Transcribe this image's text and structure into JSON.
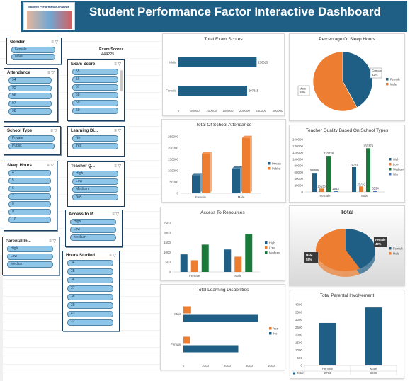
{
  "header": {
    "title": "Student Performance Factor Interactive Dashboard",
    "thumb_title": "Student Performance Analysis"
  },
  "kpi": {
    "label": "Exam Scores",
    "value": "444225"
  },
  "slicers": {
    "gender": {
      "title": "Gender",
      "items": [
        "Female",
        "Male"
      ]
    },
    "attendance": {
      "title": "Attendance",
      "items": [
        "94",
        "95",
        "96",
        "97",
        "98"
      ]
    },
    "exam_score": {
      "title": "Exam Score",
      "items": [
        "55",
        "56",
        "57",
        "58",
        "59",
        "60",
        "61"
      ]
    },
    "school_type": {
      "title": "School Type",
      "items": [
        "Private",
        "Public"
      ]
    },
    "learning_disabilities": {
      "title": "Learning Di...",
      "items": [
        "No",
        "Yes"
      ]
    },
    "sleep_hours": {
      "title": "Sleep Hours",
      "items": [
        "4",
        "5",
        "6",
        "7",
        "8",
        "9",
        "10"
      ]
    },
    "teacher_quality": {
      "title": "Teacher Q...",
      "items": [
        "High",
        "Low",
        "Medium",
        "N/A"
      ]
    },
    "access_to_resources": {
      "title": "Access to R...",
      "items": [
        "High",
        "Low",
        "Medium"
      ]
    },
    "parental_involvement": {
      "title": "Parental In...",
      "items": [
        "High",
        "Low",
        "Medium"
      ]
    },
    "hours_studied": {
      "title": "Hours Studied",
      "items": [
        "34",
        "35",
        "36",
        "37",
        "38",
        "39",
        "43",
        "44"
      ]
    }
  },
  "chart_data": [
    {
      "id": "total_exam_scores",
      "type": "bar",
      "orientation": "horizontal",
      "title": "Total Exam Scores",
      "categories": [
        "Female",
        "Male"
      ],
      "values": [
        207815,
        236615
      ],
      "value_labels": [
        "207815",
        "236615"
      ],
      "xlim": [
        0,
        300000
      ],
      "xticks": [
        "0",
        "50000",
        "100000",
        "150000",
        "200000",
        "250000",
        "300000"
      ],
      "colors": {
        "bar": "#1f5f86"
      }
    },
    {
      "id": "sleep_hours_pie",
      "type": "pie",
      "title": "Percentage Of Sleep Hours",
      "categories": [
        "Female",
        "Male"
      ],
      "values": [
        42,
        58
      ],
      "labels": [
        "Female\n42%",
        "Male\n58%"
      ],
      "colors": [
        "#1f5f86",
        "#ed7d31"
      ],
      "legend": "right"
    },
    {
      "id": "school_attendance",
      "type": "bar",
      "title": "Total Of School Attendance",
      "categories": [
        "Female",
        "Male"
      ],
      "series": [
        {
          "name": "Private",
          "values": [
            80000,
            110000
          ],
          "color": "#1f5f86"
        },
        {
          "name": "Public",
          "values": [
            175000,
            245000
          ],
          "color": "#ed7d31"
        }
      ],
      "ylim": [
        0,
        250000
      ],
      "yticks": [
        "0",
        "50000",
        "100000",
        "150000",
        "200000",
        "250000"
      ],
      "legend": "right"
    },
    {
      "id": "teacher_quality",
      "type": "bar",
      "title": "Teacher Quality Based On School Types",
      "categories": [
        "Female",
        "Male"
      ],
      "series": [
        {
          "name": "High",
          "values": [
            58069,
            75775
          ],
          "color": "#1f5f86"
        },
        {
          "name": "Low",
          "values": [
            10130,
            16733
          ],
          "color": "#ed7d31"
        },
        {
          "name": "Medium",
          "values": [
            110038,
            133373
          ],
          "color": "#1a7a3a"
        },
        {
          "name": "N/A",
          "values": [
            2663,
            3534
          ],
          "color": "#4472c4"
        }
      ],
      "value_labels": [
        [
          "58069",
          "10130",
          "110038",
          "2663"
        ],
        [
          "75775",
          "16733",
          "133373",
          "3534"
        ]
      ],
      "ylim": [
        0,
        160000
      ],
      "yticks": [
        "0",
        "20000",
        "40000",
        "60000",
        "80000",
        "100000",
        "120000",
        "140000",
        "160000"
      ],
      "legend": "right"
    },
    {
      "id": "access_to_resources",
      "type": "bar",
      "title": "Access To Resources",
      "categories": [
        "Female",
        "Male"
      ],
      "series": [
        {
          "name": "High",
          "values": [
            900,
            1150
          ],
          "color": "#1f5f86"
        },
        {
          "name": "Low",
          "values": [
            600,
            780
          ],
          "color": "#ed7d31"
        },
        {
          "name": "Medium",
          "values": [
            1400,
            1950
          ],
          "color": "#1a7a3a"
        }
      ],
      "ylim": [
        0,
        2500
      ],
      "yticks": [
        "0",
        "500",
        "1000",
        "1500",
        "2000",
        "2500"
      ],
      "legend": "right"
    },
    {
      "id": "total_pie_3d",
      "type": "pie",
      "title": "Total",
      "categories": [
        "Female",
        "Male"
      ],
      "values": [
        42,
        58
      ],
      "labels": [
        "Female\n42%",
        "Male\n58%"
      ],
      "colors": [
        "#1f5f86",
        "#ed7d31"
      ],
      "legend": "right"
    },
    {
      "id": "learning_disabilities",
      "type": "bar",
      "orientation": "horizontal",
      "title": "Total Learning Disabilities",
      "categories": [
        "Female",
        "Male"
      ],
      "series": [
        {
          "name": "Yes",
          "values": [
            300,
            350
          ],
          "color": "#ed7d31"
        },
        {
          "name": "No",
          "values": [
            2500,
            3400
          ],
          "color": "#1f5f86"
        }
      ],
      "xlim": [
        0,
        4000
      ],
      "xticks": [
        "0",
        "1000",
        "2000",
        "3000",
        "4000"
      ],
      "legend": "right"
    },
    {
      "id": "parental_involvement",
      "type": "bar",
      "title": "Total Parental Involvement",
      "categories": [
        "Female",
        "Male"
      ],
      "values": [
        2793,
        3808
      ],
      "value_labels": [
        "2793",
        "3808"
      ],
      "table_label": "Total",
      "ylim": [
        0,
        4000
      ],
      "yticks": [
        "0",
        "500",
        "1000",
        "1500",
        "2000",
        "2500",
        "3000",
        "3500",
        "4000"
      ],
      "colors": {
        "bar": "#1f5f86"
      }
    }
  ]
}
